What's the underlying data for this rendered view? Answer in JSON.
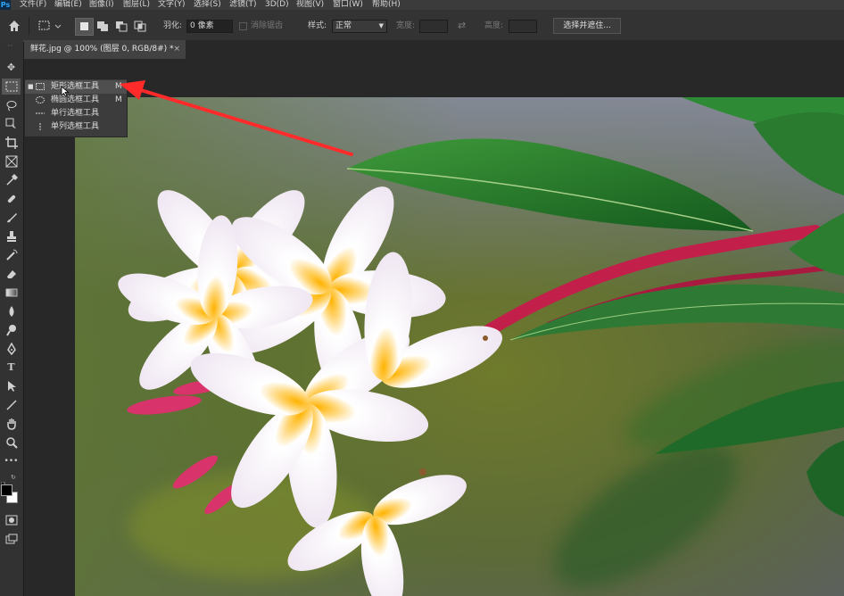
{
  "menubar": {
    "logo": "Ps",
    "items": [
      "文件(F)",
      "编辑(E)",
      "图像(I)",
      "图层(L)",
      "文字(Y)",
      "选择(S)",
      "滤镜(T)",
      "3D(D)",
      "视图(V)",
      "窗口(W)",
      "帮助(H)"
    ]
  },
  "options_bar": {
    "feather_label": "羽化:",
    "feather_value": "0 像素",
    "antialias_label": "消除锯齿",
    "style_label": "样式:",
    "style_value": "正常",
    "width_label": "宽度:",
    "height_label": "高度:",
    "select_mask_button": "选择并遮住..."
  },
  "document_tab": {
    "title": "鲜花.jpg @ 100% (图层 0, RGB/8#) *",
    "close": "×"
  },
  "flyout": {
    "items": [
      {
        "label": "矩形选框工具",
        "key": "M",
        "icon": "rect-marquee-icon",
        "selected": true
      },
      {
        "label": "椭圆选框工具",
        "key": "M",
        "icon": "ellipse-marquee-icon",
        "selected": false
      },
      {
        "label": "单行选框工具",
        "key": "",
        "icon": "single-row-marquee-icon",
        "selected": false
      },
      {
        "label": "单列选框工具",
        "key": "",
        "icon": "single-column-marquee-icon",
        "selected": false
      }
    ]
  },
  "colors": {
    "annotation_arrow": "#ff2b2b",
    "panel_bg": "#323232",
    "canvas_bg": "#282828"
  }
}
